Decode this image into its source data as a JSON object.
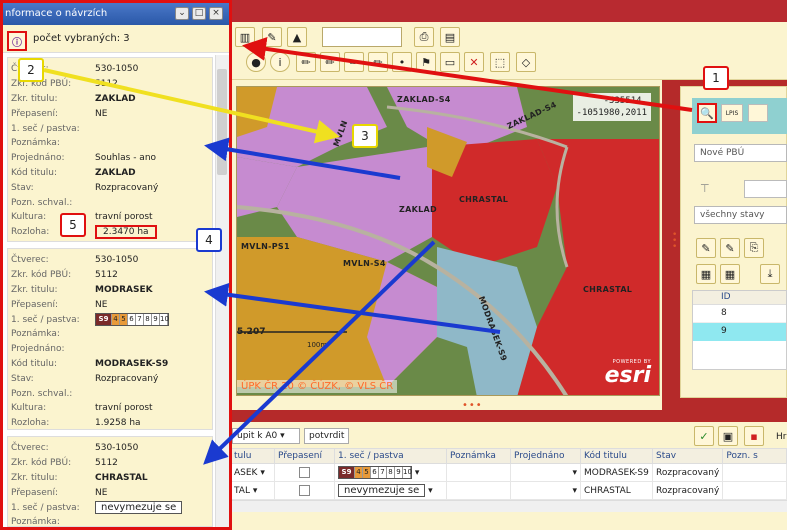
{
  "window": {
    "title": "nformace o návrzích"
  },
  "panel": {
    "count_label": "počet vybraných: 3",
    "records": [
      {
        "rows": [
          {
            "k": "Čtverec:",
            "v": "530-1050"
          },
          {
            "k": "Zkr. kód PBÚ:",
            "v": "5112"
          },
          {
            "k": "Zkr. titulu:",
            "v": "ZAKLAD"
          },
          {
            "k": "Přepasení:",
            "v": "NE"
          },
          {
            "k": "1. seč / pastva:",
            "v": ""
          },
          {
            "k": "Poznámka:",
            "v": ""
          },
          {
            "k": "Projednáno:",
            "v": "Souhlas - ano"
          },
          {
            "k": "Kód titulu:",
            "v": "ZAKLAD"
          },
          {
            "k": "Stav:",
            "v": "Rozpracovaný"
          },
          {
            "k": "Pozn. schval.:",
            "v": ""
          },
          {
            "k": "Kultura:",
            "v": "travní porost"
          },
          {
            "k": "Rozloha:",
            "v": "2.3470 ha"
          }
        ]
      },
      {
        "rows": [
          {
            "k": "Čtverec:",
            "v": "530-1050"
          },
          {
            "k": "Zkr. kód PBÚ:",
            "v": "5112"
          },
          {
            "k": "Zkr. titulu:",
            "v": "MODRASEK"
          },
          {
            "k": "Přepasení:",
            "v": "NE"
          },
          {
            "k": "1. seč / pastva:",
            "v": ""
          },
          {
            "k": "Poznámka:",
            "v": ""
          },
          {
            "k": "Projednáno:",
            "v": ""
          },
          {
            "k": "Kód titulu:",
            "v": "MODRASEK-S9"
          },
          {
            "k": "Stav:",
            "v": "Rozpracovaný"
          },
          {
            "k": "Pozn. schval.:",
            "v": ""
          },
          {
            "k": "Kultura:",
            "v": "travní porost"
          },
          {
            "k": "Rozloha:",
            "v": "1.9258 ha"
          }
        ]
      },
      {
        "rows": [
          {
            "k": "Čtverec:",
            "v": "530-1050"
          },
          {
            "k": "Zkr. kód PBÚ:",
            "v": "5112"
          },
          {
            "k": "Zkr. titulu:",
            "v": "CHRASTAL"
          },
          {
            "k": "Přepasení:",
            "v": "NE"
          },
          {
            "k": "1. seč / pastva:",
            "v": "nevymezuje se"
          },
          {
            "k": "Poznámka:",
            "v": ""
          }
        ]
      }
    ],
    "scale_values": [
      "S9",
      "4",
      "5",
      "6",
      "7",
      "8",
      "9",
      "10"
    ]
  },
  "map": {
    "coords_line1": "-535514,",
    "coords_line2": "-1051980,2011",
    "copyright": "ÚPK ČR 20  © ČÚZK, © VLS ČR",
    "esri_small": "POWERED BY",
    "esri_big": "esri",
    "scale_text": "5.207",
    "scale_unit": "100m",
    "labels": [
      "ZAKLAD-S4",
      "ZAKLAD-S4",
      "ZAKLAD",
      "CHRASTAL",
      "MVLN-PS1",
      "MVLN-S4",
      "MODRASEK-S9",
      "CHRASTAL",
      "ZAKLAD-S4",
      "MVLN"
    ]
  },
  "right": {
    "new_pbu": "Nové PBÚ",
    "states": "všechny stavy",
    "lpis": "LPIS",
    "grid_header": "ID",
    "grid_rows": [
      "8",
      "9"
    ]
  },
  "bottom": {
    "print_select": "upit k A0",
    "confirm_button": "potvrdit",
    "side_label": "Hr",
    "columns": [
      "tulu",
      "Přepasení",
      "1. seč / pastva",
      "Poznámka",
      "Projednáno",
      "Kód titulu",
      "Stav",
      "Pozn. s"
    ],
    "rows": [
      {
        "title": "ASEK",
        "seč": "scale",
        "kod": "MODRASEK-S9",
        "stav": "Rozpracovaný"
      },
      {
        "title": "TAL",
        "seč": "nevymezuje se",
        "kod": "CHRASTAL",
        "stav": "Rozpracovaný"
      }
    ]
  },
  "callouts": [
    "1",
    "2",
    "3",
    "4",
    "5"
  ]
}
